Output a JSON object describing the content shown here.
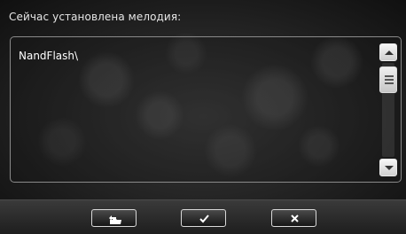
{
  "dialog": {
    "title": "Сейчас установлена мелодия:"
  },
  "list": {
    "items": [
      "NandFlash\\"
    ]
  },
  "buttons": [
    {
      "icon": "folder-back-icon"
    },
    {
      "icon": "checkmark-icon"
    },
    {
      "icon": "close-icon"
    }
  ]
}
